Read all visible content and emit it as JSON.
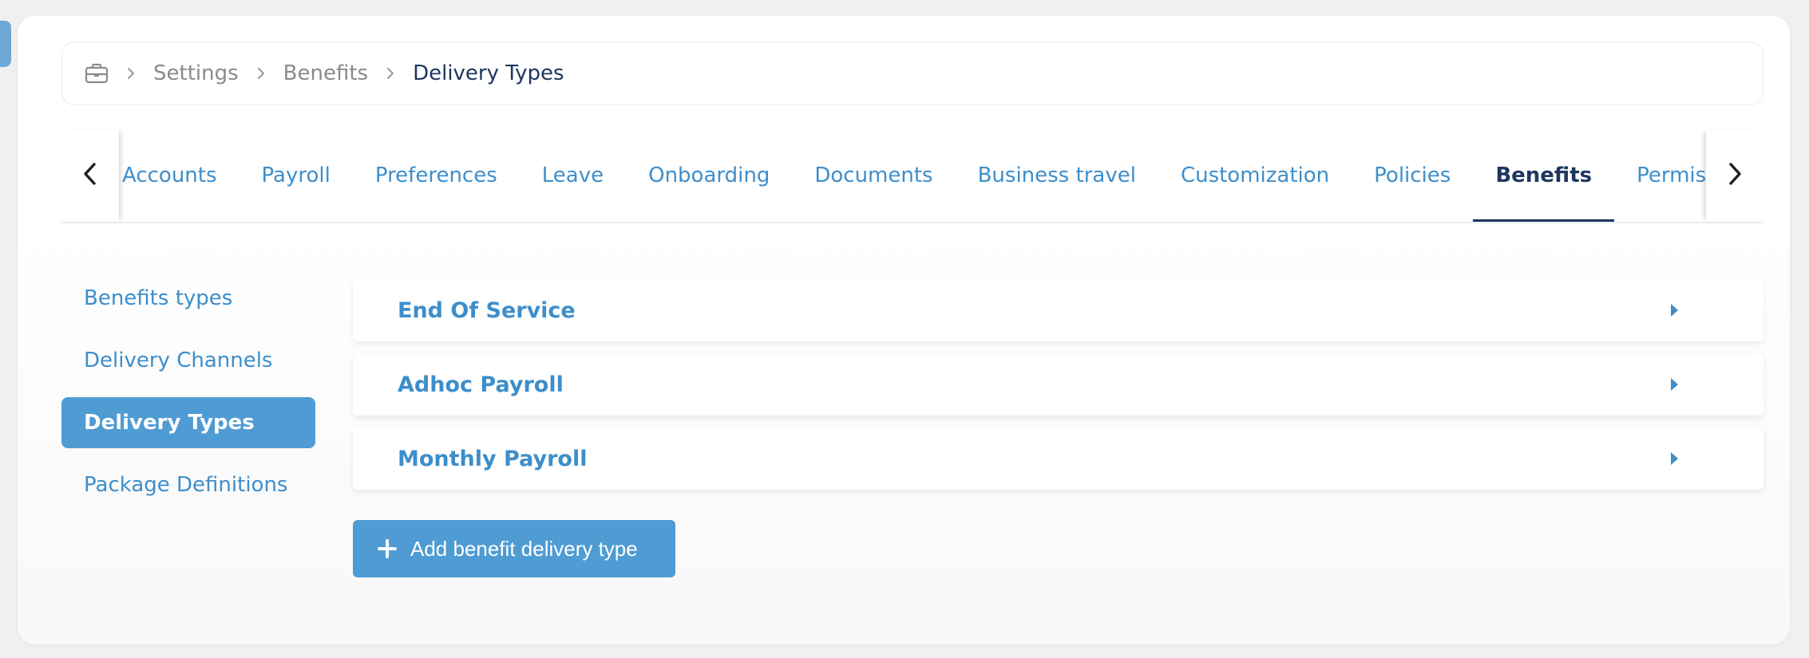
{
  "breadcrumb": {
    "icon": "briefcase-icon",
    "items": [
      "Settings",
      "Benefits"
    ],
    "current": "Delivery Types"
  },
  "tabs": {
    "items": [
      {
        "label": "Accounts",
        "active": false
      },
      {
        "label": "Payroll",
        "active": false
      },
      {
        "label": "Preferences",
        "active": false
      },
      {
        "label": "Leave",
        "active": false
      },
      {
        "label": "Onboarding",
        "active": false
      },
      {
        "label": "Documents",
        "active": false
      },
      {
        "label": "Business travel",
        "active": false
      },
      {
        "label": "Customization",
        "active": false
      },
      {
        "label": "Policies",
        "active": false
      },
      {
        "label": "Benefits",
        "active": true
      },
      {
        "label": "Permissions",
        "active": false
      }
    ],
    "prev_icon": "chevron-left-icon",
    "next_icon": "chevron-right-icon"
  },
  "sidebar": {
    "items": [
      {
        "label": "Benefits types",
        "active": false
      },
      {
        "label": "Delivery Channels",
        "active": false
      },
      {
        "label": "Delivery Types",
        "active": true
      },
      {
        "label": "Package Definitions",
        "active": false
      }
    ]
  },
  "delivery_types": {
    "items": [
      {
        "label": "End Of Service"
      },
      {
        "label": "Adhoc Payroll"
      },
      {
        "label": "Monthly Payroll"
      }
    ],
    "add_button_label": "Add benefit delivery type",
    "add_icon": "plus-icon"
  },
  "colors": {
    "accent": "#4f9bd3",
    "link": "#3d8ecb",
    "navy": "#1e3660",
    "muted": "#8b8b8b"
  }
}
